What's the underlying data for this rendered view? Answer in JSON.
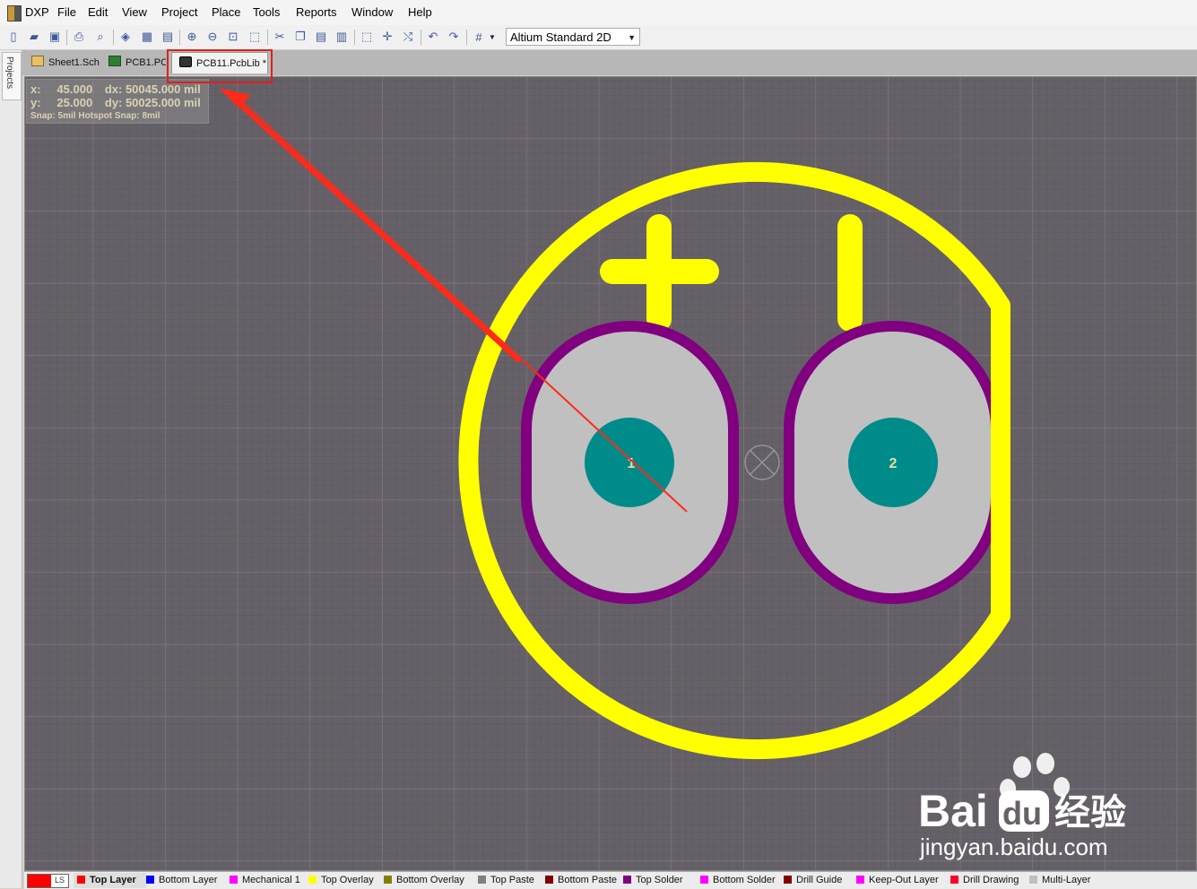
{
  "app": {
    "logo_label": "DXP",
    "menu": [
      "File",
      "Edit",
      "View",
      "Project",
      "Place",
      "Tools",
      "Reports",
      "Window",
      "Help"
    ]
  },
  "toolbar": {
    "view_mode": "Altium Standard 2D"
  },
  "side_panel": {
    "tab": "Projects"
  },
  "tabs": [
    {
      "label": "Sheet1.Sch",
      "active": false
    },
    {
      "label": "PCB1.PCB",
      "active": false
    },
    {
      "label": "PCB11.PcbLib *",
      "active": true
    }
  ],
  "coords": {
    "x_label": "x:",
    "x_value": "45.000",
    "dx_label": "dx:",
    "dx_value": "50045.000 mil",
    "y_label": "y:",
    "y_value": "25.000",
    "dy_label": "dy:",
    "dy_value": "50025.000 mil",
    "snap": "Snap: 5mil Hotspot Snap: 8mil"
  },
  "footprint": {
    "pads": [
      {
        "designator": "1"
      },
      {
        "designator": "2"
      }
    ],
    "overlay_color": "#ffff00",
    "solder_mask_color": "#800080",
    "pad_color": "#c0c0c0",
    "hole_color": "#008b8b"
  },
  "status_bar": {
    "current_layer_indicator": "LS",
    "layers": [
      {
        "name": "Top Layer",
        "color": "#ff0000",
        "current": true
      },
      {
        "name": "Bottom Layer",
        "color": "#0000ff",
        "current": false
      },
      {
        "name": "Mechanical 1",
        "color": "#ff00ff",
        "current": false
      },
      {
        "name": "Top Overlay",
        "color": "#ffff00",
        "current": false
      },
      {
        "name": "Bottom Overlay",
        "color": "#808000",
        "current": false
      },
      {
        "name": "Top Paste",
        "color": "#808080",
        "current": false
      },
      {
        "name": "Bottom Paste",
        "color": "#800000",
        "current": false
      },
      {
        "name": "Top Solder",
        "color": "#800080",
        "current": false
      },
      {
        "name": "Bottom Solder",
        "color": "#ff00ff",
        "current": false
      },
      {
        "name": "Drill Guide",
        "color": "#800000",
        "current": false
      },
      {
        "name": "Keep-Out Layer",
        "color": "#ff00ff",
        "current": false
      },
      {
        "name": "Drill Drawing",
        "color": "#ff002a",
        "current": false
      },
      {
        "name": "Multi-Layer",
        "color": "#c0c0c0",
        "current": false
      }
    ]
  },
  "watermark": {
    "brand": "Bai",
    "brand_tail": "du",
    "cn": "经验",
    "url": "jingyan.baidu.com"
  }
}
